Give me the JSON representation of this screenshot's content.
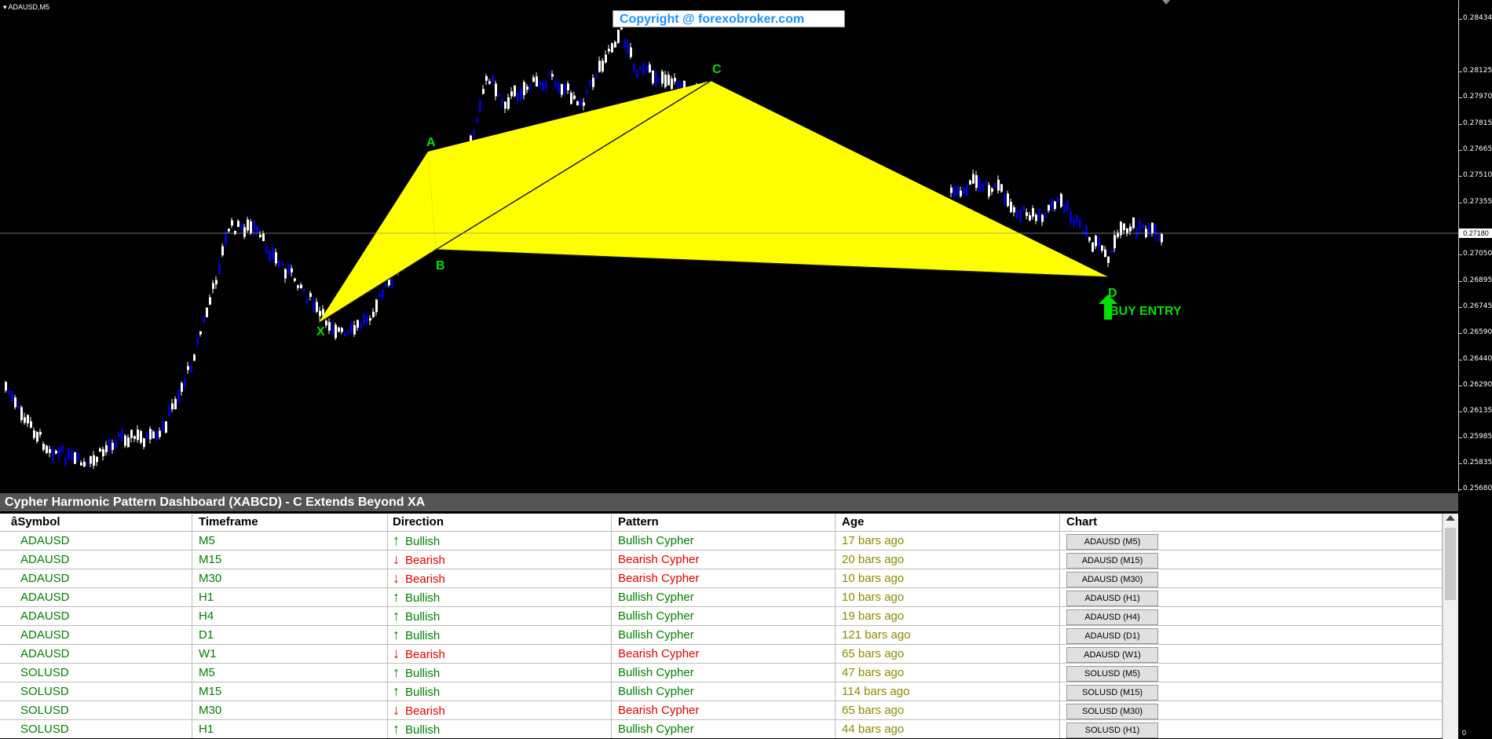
{
  "chart": {
    "symbol_title": "ADAUSD,M5",
    "copyright": "Copyright @ forexobroker.com",
    "points": {
      "X": "X",
      "A": "A",
      "B": "B",
      "C": "C",
      "D": "D"
    },
    "buy_entry": "BUY ENTRY",
    "price_levels": [
      "0.28434",
      "0.28125",
      "0.27970",
      "0.27815",
      "0.27665",
      "0.27510",
      "0.27355",
      "0.27050",
      "0.26895",
      "0.26745",
      "0.26590",
      "0.26440",
      "0.26290",
      "0.26135",
      "0.25985",
      "0.25835",
      "0.25680"
    ],
    "current_price": "0.27180",
    "zero_label": "0"
  },
  "dashboard": {
    "title": "Cypher Harmonic Pattern Dashboard (XABCD) - C Extends Beyond XA",
    "headers": [
      "âSymbol",
      "Timeframe",
      "Direction",
      "Pattern",
      "Age",
      "Chart"
    ],
    "rows": [
      {
        "symbol": "ADAUSD",
        "tf": "M5",
        "dir": "Bullish",
        "pattern": "Bullish Cypher",
        "age": "17 bars ago",
        "btn": "ADAUSD (M5)"
      },
      {
        "symbol": "ADAUSD",
        "tf": "M15",
        "dir": "Bearish",
        "pattern": "Bearish Cypher",
        "age": "20 bars ago",
        "btn": "ADAUSD (M15)"
      },
      {
        "symbol": "ADAUSD",
        "tf": "M30",
        "dir": "Bearish",
        "pattern": "Bearish Cypher",
        "age": "10 bars ago",
        "btn": "ADAUSD (M30)"
      },
      {
        "symbol": "ADAUSD",
        "tf": "H1",
        "dir": "Bullish",
        "pattern": "Bullish Cypher",
        "age": "10 bars ago",
        "btn": "ADAUSD (H1)"
      },
      {
        "symbol": "ADAUSD",
        "tf": "H4",
        "dir": "Bullish",
        "pattern": "Bullish Cypher",
        "age": "19 bars ago",
        "btn": "ADAUSD (H4)"
      },
      {
        "symbol": "ADAUSD",
        "tf": "D1",
        "dir": "Bullish",
        "pattern": "Bullish Cypher",
        "age": "121 bars ago",
        "btn": "ADAUSD (D1)"
      },
      {
        "symbol": "ADAUSD",
        "tf": "W1",
        "dir": "Bearish",
        "pattern": "Bearish Cypher",
        "age": "65 bars ago",
        "btn": "ADAUSD (W1)"
      },
      {
        "symbol": "SOLUSD",
        "tf": "M5",
        "dir": "Bullish",
        "pattern": "Bullish Cypher",
        "age": "47 bars ago",
        "btn": "SOLUSD (M5)"
      },
      {
        "symbol": "SOLUSD",
        "tf": "M15",
        "dir": "Bullish",
        "pattern": "Bullish Cypher",
        "age": "114 bars ago",
        "btn": "SOLUSD (M15)"
      },
      {
        "symbol": "SOLUSD",
        "tf": "M30",
        "dir": "Bearish",
        "pattern": "Bearish Cypher",
        "age": "65 bars ago",
        "btn": "SOLUSD (M30)"
      },
      {
        "symbol": "SOLUSD",
        "tf": "H1",
        "dir": "Bullish",
        "pattern": "Bullish Cypher",
        "age": "44 bars ago",
        "btn": "SOLUSD (H1)"
      }
    ]
  },
  "colors": {
    "bullish": "#008000",
    "bearish": "#e00000",
    "age": "#8b8b00",
    "pattern_fill": "#ffff00",
    "label_green": "#00e000",
    "candle_up": "#0000cc",
    "candle_down": "#ffffff"
  }
}
